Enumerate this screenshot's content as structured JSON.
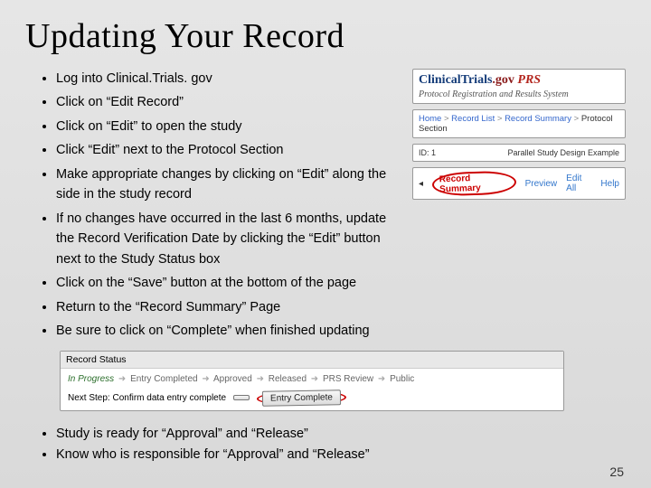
{
  "title": "Updating Your Record",
  "bullets": {
    "b0": "Log into Clinical.Trials. gov",
    "b1": "Click on “Edit Record”",
    "b2": "Click on “Edit” to open the study",
    "b3": "Click “Edit” next to the Protocol Section",
    "b4": "Make appropriate changes by clicking on “Edit” along the side in the study record",
    "b5": "If no changes have occurred in the last 6 months, update the Record Verification Date by clicking the “Edit” button next to the Study Status box",
    "b6": "Click on the “Save” button at the bottom of the page",
    "b7": "Return to the “Record Summary” Page",
    "b8": "Be sure to click on “Complete” when finished updating",
    "b9": "Study is ready for “Approval” and “Release”",
    "b10": "Know who is responsible for “Approval” and “Release”"
  },
  "prs": {
    "logo_a": "ClinicalTrials",
    "logo_b": ".gov",
    "logo_c": " PRS",
    "subtitle": "Protocol Registration and Results System",
    "crumb_home": "Home",
    "crumb_list": "Record List",
    "crumb_summary": "Record Summary",
    "crumb_section": "Protocol Section",
    "id_line": "ID: 1",
    "id_title": "Parallel Study Design Example",
    "nav_summary": "Record Summary",
    "nav_preview": "Preview",
    "nav_editall": "Edit All",
    "nav_help": "Help"
  },
  "status": {
    "heading": "Record Status",
    "s0": "In Progress",
    "s1": "Entry Completed",
    "s2": "Approved",
    "s3": "Released",
    "s4": "PRS Review",
    "s5": "Public",
    "next_label": "Next Step: Confirm data entry complete",
    "btn_complete": "Entry Complete",
    "btn_other": " "
  },
  "page_number": "25"
}
